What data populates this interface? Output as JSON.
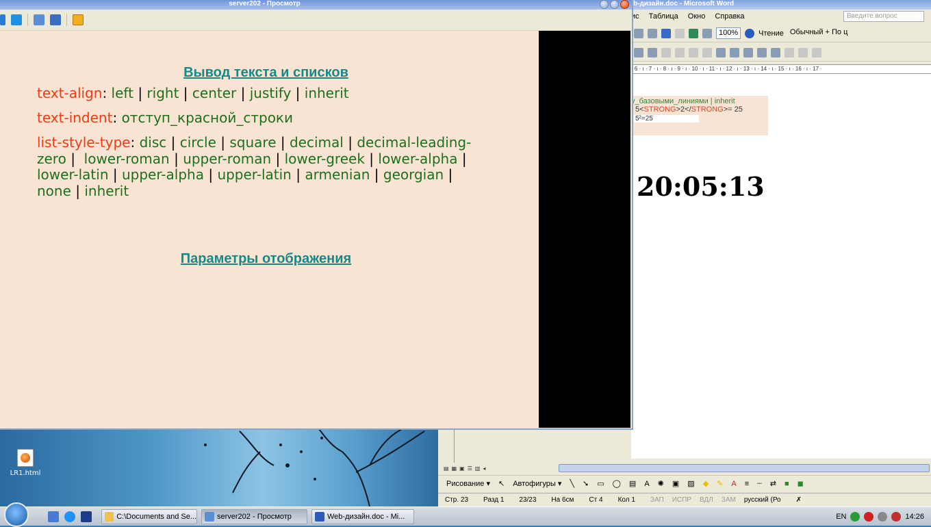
{
  "desktop": {
    "icon_label": "LR1.html"
  },
  "word": {
    "title": "b-дизайн.doc - Microsoft Word",
    "menu": [
      "ис",
      "Таблица",
      "Окно",
      "Справка"
    ],
    "question_placeholder": "Введите вопрос",
    "zoom": "100%",
    "reading": "Чтение",
    "style": "Обычный + По ц",
    "ruler": "· 6 · ı · 7 · ı · 8 · ı · 9 · ı · 10 · ı · 11 · ı · 12 · ı · 13 · ı · 14 · ı · 15 · ı · 16 · ı · 17 ·",
    "snippet_line1": "у_базовыми_линиями | inherit",
    "snippet_line2_pre": "5<",
    "snippet_line2_tag1": "STRONG",
    "snippet_line2_mid": ">2</",
    "snippet_line2_tag2": "STRONG",
    "snippet_line2_post": ">= 25",
    "snippet_line3": "5²=25",
    "clock": "20:05:13",
    "drawing_label": "Рисование ▾",
    "autoshapes_label": "Автофигуры ▾",
    "status": {
      "page": "Стр. 23",
      "section": "Разд 1",
      "pages": "23/23",
      "at": "На 6см",
      "line": "Ст 4",
      "col": "Кол 1",
      "rec": "ЗАП",
      "trk": "ИСПР",
      "ext": "ВДЛ",
      "ovr": "ЗАМ",
      "lang": "русский (Ро"
    }
  },
  "preview": {
    "title": "server202 - Просмотр",
    "heading1": "Вывод текста и списков",
    "heading2": "Параметры отображения",
    "text_align": {
      "key": "text-align",
      "values": [
        "left",
        "right",
        "center",
        "justify",
        "inherit"
      ]
    },
    "text_indent": {
      "key": "text-indent",
      "value": "отступ_красной_строки"
    },
    "list_style_type": {
      "key": "list-style-type",
      "line1": [
        "disc",
        "circle",
        "square",
        "decimal",
        "decimal-leading-"
      ],
      "line2_start": "zero",
      "line2": [
        "lower-roman",
        "upper-roman",
        "lower-greek",
        "lower-alpha"
      ],
      "line3": [
        "lower-latin",
        "upper-alpha",
        "upper-latin",
        "armenian",
        "georgian"
      ],
      "line4": [
        "none",
        "inherit"
      ]
    }
  },
  "taskbar": {
    "tasks": [
      {
        "label": "C:\\Documents and Se..."
      },
      {
        "label": "server202 - Просмотр"
      },
      {
        "label": "Web-дизайн.doc - Mi..."
      }
    ],
    "lang": "EN",
    "time": "14:26"
  },
  "colors": {
    "heading": "#138a8a",
    "property_key": "#ef3a16",
    "property_value": "#1d6f1d",
    "content_bg": "#f9e4d3"
  }
}
